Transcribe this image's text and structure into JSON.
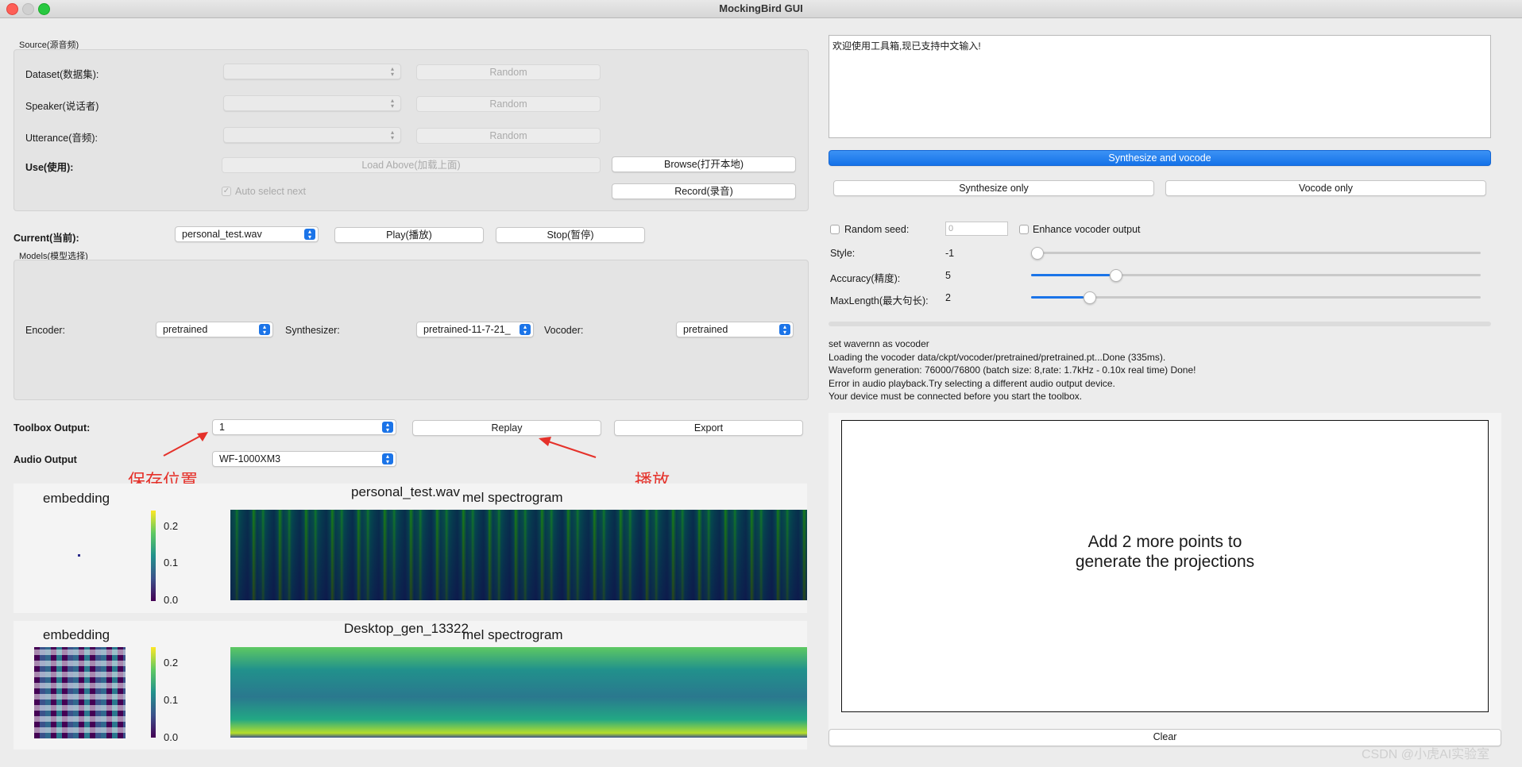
{
  "window": {
    "title": "MockingBird GUI"
  },
  "source": {
    "group_title": "Source(源音频)",
    "dataset_label": "Dataset(数据集):",
    "speaker_label": "Speaker(说话者)",
    "utterance_label": "Utterance(音频):",
    "random_label": "Random",
    "use_label": "Use(使用):",
    "load_above_label": "Load Above(加载上面)",
    "browse_label": "Browse(打开本地)",
    "record_label": "Record(录音)",
    "auto_select_label": "Auto select next"
  },
  "current": {
    "label": "Current(当前):",
    "value": "personal_test.wav",
    "play_label": "Play(播放)",
    "stop_label": "Stop(暂停)"
  },
  "models": {
    "group_title": "Models(模型选择)",
    "encoder_label": "Encoder:",
    "encoder_value": "pretrained",
    "synthesizer_label": "Synthesizer:",
    "synthesizer_value": "pretrained-11-7-21_",
    "vocoder_label": "Vocoder:",
    "vocoder_value": "pretrained"
  },
  "output": {
    "toolbox_label": "Toolbox Output:",
    "toolbox_value": "1",
    "replay_label": "Replay",
    "export_label": "Export",
    "audio_label": "Audio Output",
    "audio_value": "WF-1000XM3"
  },
  "annotations": {
    "save_location": "保存位置",
    "play": "播放"
  },
  "plots": [
    {
      "embedding_title": "embedding",
      "file_title": "personal_test.wav",
      "mel_title": "mel spectrogram",
      "colorbar_ticks": [
        "0.2",
        "0.1",
        "0.0"
      ]
    },
    {
      "embedding_title": "embedding",
      "file_title": "Desktop_gen_13322",
      "mel_title": "mel spectrogram",
      "colorbar_ticks": [
        "0.2",
        "0.1",
        "0.0"
      ]
    }
  ],
  "text_input": {
    "value": "欢迎使用工具箱,现已支持中文输入!"
  },
  "actions": {
    "synthesize_vocode": "Synthesize and vocode",
    "synthesize_only": "Synthesize only",
    "vocode_only": "Vocode only"
  },
  "settings": {
    "random_seed_label": "Random seed:",
    "random_seed_value": "0",
    "enhance_label": "Enhance vocoder output",
    "style_label": "Style:",
    "style_value": "-1",
    "style_level": 0.0,
    "accuracy_label": "Accuracy(精度):",
    "accuracy_value": "5",
    "accuracy_level": 0.18,
    "maxlength_label": "MaxLength(最大句长):",
    "maxlength_value": "2",
    "maxlength_level": 0.12
  },
  "log": {
    "lines": [
      "set wavernn as vocoder",
      "Loading the vocoder data/ckpt/vocoder/pretrained/pretrained.pt...Done (335ms).",
      "Waveform generation: 76000/76800 (batch size: 8,rate: 1.7kHz - 0.10x real time) Done!",
      "Error in audio playback.Try selecting a different audio output device.",
      "Your device must be connected before you start the toolbox."
    ]
  },
  "projection": {
    "line1": "Add 2 more points to",
    "line2": "generate the projections"
  },
  "clear_label": "Clear",
  "watermark": "CSDN @小虎AI实验室",
  "colors": {
    "accent": "#1b74e8",
    "annotation": "#e5312a"
  }
}
